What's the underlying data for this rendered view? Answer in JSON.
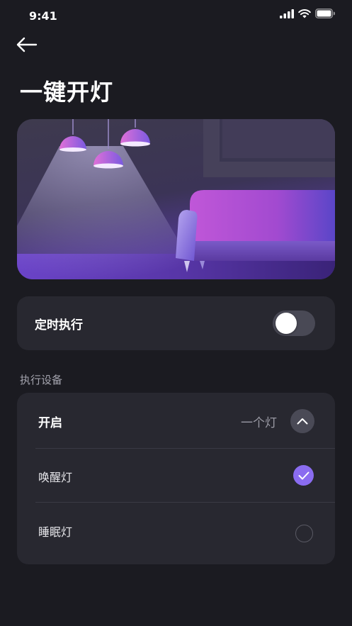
{
  "status_bar": {
    "time": "9:41"
  },
  "header": {
    "title": "一键开灯"
  },
  "timer": {
    "label": "定时执行",
    "enabled": false
  },
  "section": {
    "label": "执行设备"
  },
  "devices": {
    "action_label": "开启",
    "count_label": "一个灯",
    "expanded": true,
    "items": [
      {
        "name": "唤醒灯",
        "checked": true
      },
      {
        "name": "睡眠灯",
        "checked": false
      }
    ]
  },
  "colors": {
    "accent": "#8a6cf0",
    "background": "#1b1b21",
    "card": "#282830"
  }
}
